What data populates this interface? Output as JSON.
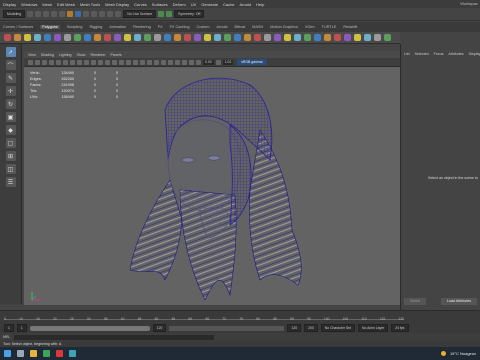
{
  "menubar": {
    "items": [
      "Display",
      "Windows",
      "Mesh",
      "Edit Mesh",
      "Mesh Tools",
      "Mesh Display",
      "Curves",
      "Surfaces",
      "Deform",
      "UV",
      "Generate",
      "Cache",
      "Arnold",
      "Help"
    ],
    "workspace": "Workspac"
  },
  "statusline": {
    "mode": "Modeling",
    "live_surface": "No Live Surface",
    "symmetry": "Symmetry: Off"
  },
  "shelf": {
    "tabs": [
      "Curves / Surfaces",
      "Polygons",
      "Sculpting",
      "Rigging",
      "Animation",
      "Rendering",
      "FX",
      "FX Caching",
      "Custom",
      "Arnold",
      "Bifrost",
      "MASH",
      "Motion Graphics",
      "XGen",
      "TURTLE",
      "Redshift"
    ],
    "active_tab": "Polygons"
  },
  "panel": {
    "menu": [
      "View",
      "Shading",
      "Lighting",
      "Show",
      "Renderer",
      "Panels"
    ],
    "field_a": "0.00",
    "field_b": "1.00",
    "color_space": "sRGB gamma"
  },
  "hud": {
    "rows": [
      {
        "label": "Verts:",
        "a": "134490",
        "b": "0",
        "c": "0"
      },
      {
        "label": "Edges:",
        "a": "262260",
        "b": "0",
        "c": "0"
      },
      {
        "label": "Faces:",
        "a": "241998",
        "b": "0",
        "c": "0"
      },
      {
        "label": "Tris:",
        "a": "120974",
        "b": "0",
        "c": "0"
      },
      {
        "label": "UVs:",
        "a": "136490",
        "b": "0",
        "c": "0"
      }
    ]
  },
  "attribute_editor": {
    "tabs": [
      "List",
      "Selected",
      "Focus",
      "Attributes",
      "Display"
    ],
    "message": "Select an object in the scene to",
    "btn_select": "Select",
    "btn_load": "Load Attributes"
  },
  "timeline": {
    "ticks": [
      "5",
      "10",
      "15",
      "20",
      "25",
      "30",
      "35",
      "40",
      "45",
      "50",
      "55",
      "60",
      "65",
      "70",
      "75",
      "80",
      "85",
      "90",
      "95",
      "100",
      "105",
      "110",
      "115",
      "120"
    ]
  },
  "range": {
    "start": "1",
    "start2": "1",
    "mid": "120",
    "end": "120",
    "end2": "200",
    "character_set": "No Character Set",
    "anim_layer": "No Anim Layer",
    "fps": "24 fps"
  },
  "cmdline": {
    "lang": "MEL"
  },
  "helpline": {
    "text": "Tool: Select object, beginning with: A"
  },
  "taskbar": {
    "weather": "19°C Nuageux"
  },
  "colors": {
    "wireframe": "#2a1f9a",
    "viewport_bg": "#636363",
    "accent": "#5b87b5"
  }
}
